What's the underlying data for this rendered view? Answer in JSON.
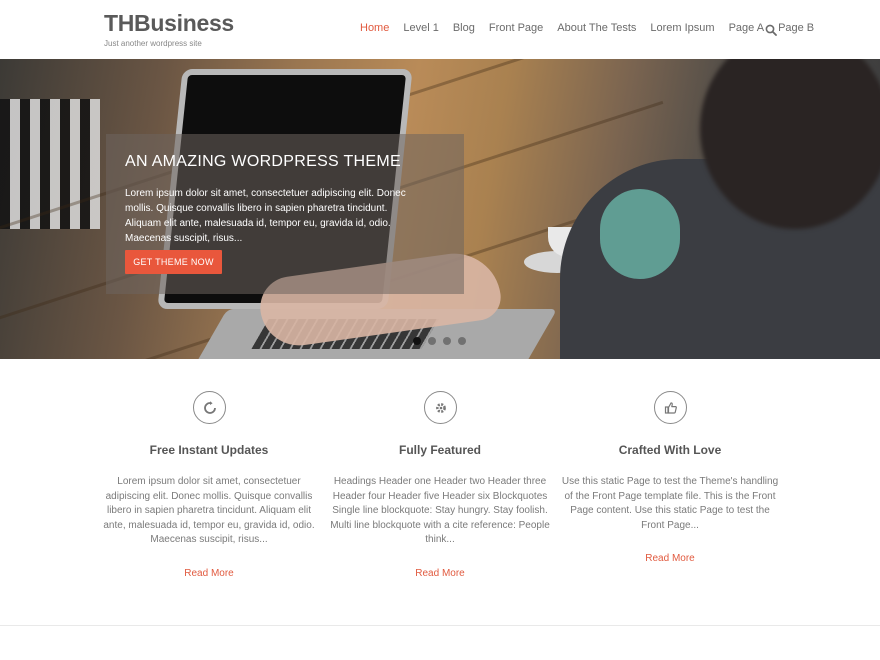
{
  "site": {
    "title": "THBusiness",
    "tagline": "Just another wordpress site"
  },
  "nav": {
    "items": [
      {
        "label": "Home",
        "active": true
      },
      {
        "label": "Level 1"
      },
      {
        "label": "Blog"
      },
      {
        "label": "Front Page"
      },
      {
        "label": "About The Tests"
      },
      {
        "label": "Lorem Ipsum"
      },
      {
        "label": "Page A"
      },
      {
        "label": "Page B"
      }
    ],
    "search_icon": "search-icon"
  },
  "hero": {
    "title": "AN AMAZING WORDPRESS THEME",
    "text": "Lorem ipsum dolor sit amet, consectetuer adipiscing elit. Donec mollis. Quisque convallis libero in sapien pharetra tincidunt. Aliquam elit ante, malesuada id, tempor eu, gravida id, odio. Maecenas suscipit, risus...",
    "button_label": "GET THEME NOW",
    "slides_count": 4,
    "active_slide": 1
  },
  "features": [
    {
      "icon": "refresh-icon",
      "title": "Free Instant Updates",
      "text": "Lorem ipsum dolor sit amet, consectetuer adipiscing elit. Donec mollis. Quisque convallis libero in sapien pharetra tincidunt. Aliquam elit ante, malesuada id, tempor eu, gravida id, odio. Maecenas suscipit, risus...",
      "link": "Read More"
    },
    {
      "icon": "gear-icon",
      "title": "Fully Featured",
      "text": "Headings Header one Header two Header three Header four Header five Header six Blockquotes Single line blockquote: Stay hungry. Stay foolish. Multi line blockquote with a cite reference: People think...",
      "link": "Read More"
    },
    {
      "icon": "thumbs-up-icon",
      "title": "Crafted With Love",
      "text": "Use this static Page to test the Theme's handling of the Front Page template file. This is the Front Page content. Use this static Page to test the Front Page...",
      "link": "Read More"
    }
  ],
  "colors": {
    "accent": "#e15a3f",
    "button": "#e9573c"
  }
}
